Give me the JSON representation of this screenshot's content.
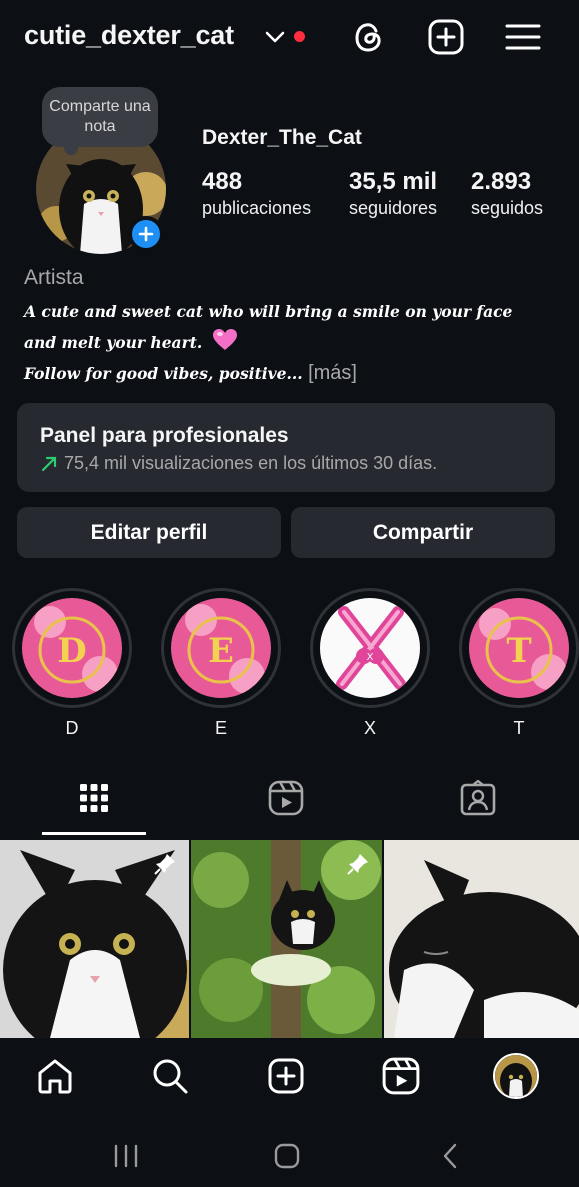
{
  "header": {
    "username": "cutie_dexter_cat",
    "icons": [
      "chevron-down-icon",
      "threads-icon",
      "create-icon",
      "menu-icon"
    ],
    "notification_color": "#ff2d3d"
  },
  "profile": {
    "note_text": "Comparte una nota",
    "display_name": "Dexter_The_Cat",
    "stats": [
      {
        "num": "488",
        "label": "publicaciones"
      },
      {
        "num": "35,5 mil",
        "label": "seguidores"
      },
      {
        "num": "2.893",
        "label": "seguidos"
      }
    ],
    "category": "Artista",
    "bio_line1": "A cute and sweet cat who will bring a smile on your face",
    "bio_line2": "and melt your heart.",
    "bio_line3": "Follow for good vibes, positive...",
    "bio_more": "[más]"
  },
  "pro_panel": {
    "title": "Panel para profesionales",
    "subtitle": "75,4 mil visualizaciones en los últimos 30 días.",
    "trend_color": "#2ecc71"
  },
  "buttons": {
    "edit": "Editar perfil",
    "share": "Compartir"
  },
  "highlights": [
    {
      "label": "D",
      "letter": "D"
    },
    {
      "label": "E",
      "letter": "E"
    },
    {
      "label": "X",
      "letter": "X"
    },
    {
      "label": "T",
      "letter": "T"
    }
  ],
  "tabs": [
    "grid-icon",
    "reels-icon",
    "tagged-icon"
  ],
  "bottom_nav": [
    "home-icon",
    "search-icon",
    "create-icon",
    "reels-icon",
    "profile-avatar"
  ],
  "accent_color": "#1e90f5"
}
